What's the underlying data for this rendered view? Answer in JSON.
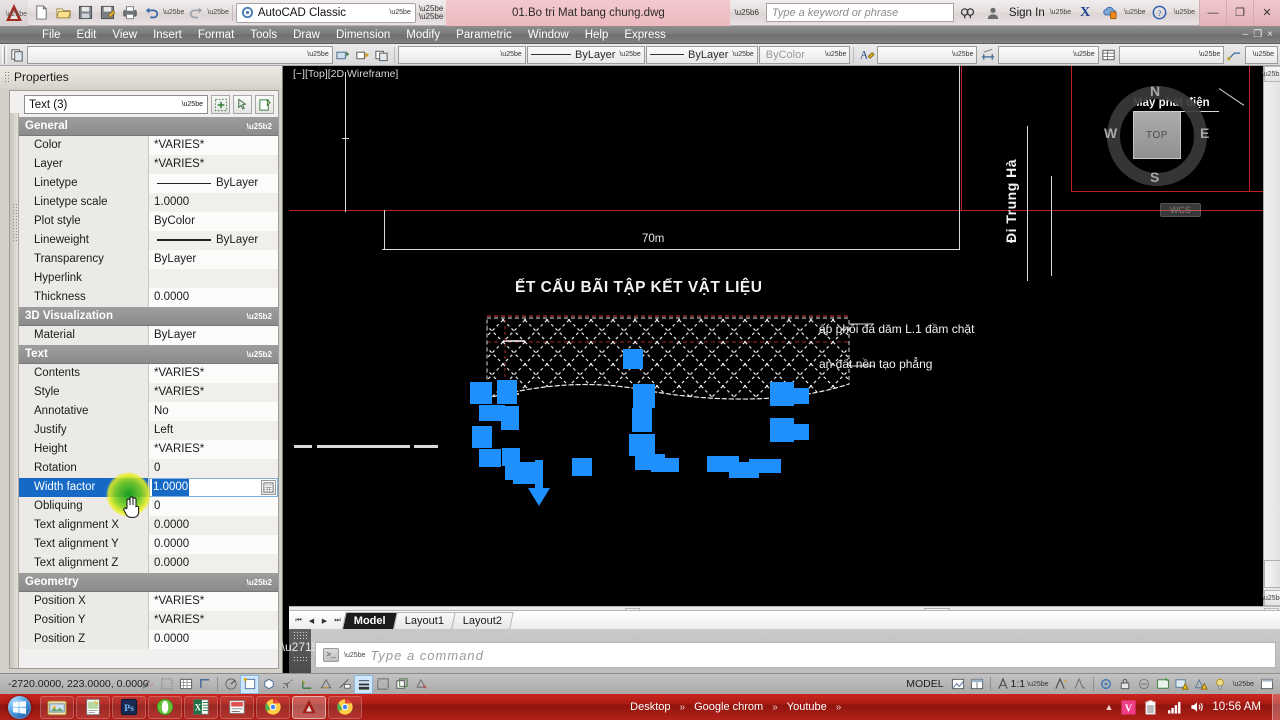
{
  "titlebar": {
    "quick_access": [
      {
        "name": "new-icon",
        "label": "New"
      },
      {
        "name": "open-icon",
        "label": "Open"
      },
      {
        "name": "save-icon",
        "label": "Save"
      },
      {
        "name": "save-as-icon",
        "label": "Save As"
      },
      {
        "name": "plot-icon",
        "label": "Plot"
      },
      {
        "name": "undo-icon",
        "label": "Undo"
      },
      {
        "name": "redo-icon",
        "label": "Redo"
      }
    ],
    "workspace": "AutoCAD Classic",
    "document_name": "01.Bo tri Mat bang chung.dwg",
    "search_placeholder": "Type a keyword or phrase",
    "sign_in": "Sign In",
    "window_buttons": {
      "minimize": "—",
      "restore": "❐",
      "close": "✕"
    }
  },
  "menubar": {
    "items": [
      "File",
      "Edit",
      "View",
      "Insert",
      "Format",
      "Tools",
      "Draw",
      "Dimension",
      "Modify",
      "Parametric",
      "Window",
      "Help",
      "Express"
    ],
    "doc_window_buttons": {
      "minimize": "–",
      "restore": "❐",
      "close": "×"
    }
  },
  "toolbar": {
    "layer_combo": "",
    "linetype_combo": "ByLayer",
    "lineweight_combo": "ByLayer",
    "plotstyle_combo": "ByColor",
    "textstyle_combo": "",
    "dimstyle_combo": "",
    "tablestyle_combo": "",
    "multileader_combo": ""
  },
  "properties": {
    "title": "Properties",
    "selection": "Text (3)",
    "toolbuttons": [
      {
        "name": "quick-select-button",
        "label": "Quick Select"
      },
      {
        "name": "select-objects-button",
        "label": "Select Objects"
      },
      {
        "name": "toggle-pickadd-button",
        "label": "Toggle PICKADD"
      }
    ],
    "categories": [
      {
        "name": "General",
        "rows": [
          {
            "key": "Color",
            "value": "*VARIES*",
            "type": "text"
          },
          {
            "key": "Layer",
            "value": "*VARIES*",
            "type": "text"
          },
          {
            "key": "Linetype",
            "value": "ByLayer",
            "type": "line"
          },
          {
            "key": "Linetype scale",
            "value": "1.0000",
            "type": "text"
          },
          {
            "key": "Plot style",
            "value": "ByColor",
            "type": "text"
          },
          {
            "key": "Lineweight",
            "value": "ByLayer",
            "type": "line"
          },
          {
            "key": "Transparency",
            "value": "ByLayer",
            "type": "text"
          },
          {
            "key": "Hyperlink",
            "value": "",
            "type": "text"
          },
          {
            "key": "Thickness",
            "value": "0.0000",
            "type": "text"
          }
        ]
      },
      {
        "name": "3D Visualization",
        "rows": [
          {
            "key": "Material",
            "value": "ByLayer",
            "type": "text"
          }
        ]
      },
      {
        "name": "Text",
        "rows": [
          {
            "key": "Contents",
            "value": "*VARIES*",
            "type": "text"
          },
          {
            "key": "Style",
            "value": "*VARIES*",
            "type": "text"
          },
          {
            "key": "Annotative",
            "value": "No",
            "type": "text"
          },
          {
            "key": "Justify",
            "value": "Left",
            "type": "text"
          },
          {
            "key": "Height",
            "value": "*VARIES*",
            "type": "text"
          },
          {
            "key": "Rotation",
            "value": "0",
            "type": "text"
          },
          {
            "key": "Width factor",
            "value": "1.0000",
            "type": "editing"
          },
          {
            "key": "Obliquing",
            "value": "0",
            "type": "text"
          },
          {
            "key": "Text alignment X",
            "value": "0.0000",
            "type": "text"
          },
          {
            "key": "Text alignment Y",
            "value": "0.0000",
            "type": "text"
          },
          {
            "key": "Text alignment Z",
            "value": "0.0000",
            "type": "text"
          }
        ]
      },
      {
        "name": "Geometry",
        "rows": [
          {
            "key": "Position X",
            "value": "*VARIES*",
            "type": "text"
          },
          {
            "key": "Position Y",
            "value": "*VARIES*",
            "type": "text"
          },
          {
            "key": "Position Z",
            "value": "0.0000",
            "type": "text"
          }
        ]
      }
    ]
  },
  "canvas": {
    "viewport_label": "[−][Top][2D Wireframe]",
    "dimension_label": "70m",
    "road_label": "Đi Trung Hà",
    "generator_label": "Máy phát điện",
    "drawing_title": "ẾT CẤU BÃI TẬP KẾT VẬT LIỆU",
    "annotation_1": "ấp phối đá dăm L.1 đầm chặt",
    "annotation_2": "an đất nền tạo phẳng",
    "viewcube": {
      "face": "TOP",
      "north": "N",
      "south": "S",
      "east": "E",
      "west": "W",
      "ucs": "WCS"
    },
    "colors": {
      "background": "#000000",
      "selection_grip": "#1e90ff",
      "construction_red": "#c02020",
      "geometry_white": "#d9d9d9"
    }
  },
  "layout_tabs": {
    "nav": [
      "⏮",
      "◀",
      "▶",
      "⏭"
    ],
    "tabs": [
      {
        "label": "Model",
        "active": true
      },
      {
        "label": "Layout1",
        "active": false
      },
      {
        "label": "Layout2",
        "active": false
      }
    ]
  },
  "command_line": {
    "placeholder": "Type a command",
    "prompt_glyph": ">_"
  },
  "statusbar": {
    "coordinates": "-2720.0000, 223.0000, 0.0000",
    "toggles": [
      {
        "name": "infer-constraints-toggle",
        "on": false
      },
      {
        "name": "snap-mode-toggle",
        "on": false
      },
      {
        "name": "grid-display-toggle",
        "on": false
      },
      {
        "name": "ortho-mode-toggle",
        "on": false
      },
      {
        "name": "polar-tracking-toggle",
        "on": false
      },
      {
        "name": "object-snap-toggle",
        "on": true
      },
      {
        "name": "3d-object-snap-toggle",
        "on": false
      },
      {
        "name": "object-snap-tracking-toggle",
        "on": false
      },
      {
        "name": "allow-ucs-toggle",
        "on": false
      },
      {
        "name": "dynamic-ucs-toggle",
        "on": false
      },
      {
        "name": "dynamic-input-toggle",
        "on": false
      },
      {
        "name": "lineweight-toggle",
        "on": true
      },
      {
        "name": "transparency-toggle",
        "on": false
      },
      {
        "name": "selection-cycling-toggle",
        "on": false
      },
      {
        "name": "annotation-monitor-toggle",
        "on": false
      }
    ],
    "space_button": "MODEL",
    "annotation_scale": "1:1",
    "right_icons": [
      {
        "name": "viewport-icon"
      },
      {
        "name": "layout-icon"
      },
      {
        "name": "annotation-visibility-icon"
      },
      {
        "name": "auto-scale-icon"
      },
      {
        "name": "workspace-gear-icon"
      },
      {
        "name": "lock-toolbars-icon"
      },
      {
        "name": "isolate-objects-icon"
      },
      {
        "name": "hardware-accel-icon"
      },
      {
        "name": "tray-warning-icon"
      },
      {
        "name": "clean-screen-icon"
      }
    ]
  },
  "taskbar": {
    "start_label": "Start",
    "pinned": [
      {
        "name": "taskbar-explorer",
        "active": false
      },
      {
        "name": "taskbar-notepad",
        "active": false
      },
      {
        "name": "taskbar-photoshop",
        "active": false
      },
      {
        "name": "taskbar-opera",
        "active": false
      },
      {
        "name": "taskbar-excel",
        "active": false
      },
      {
        "name": "taskbar-unikey",
        "active": false
      },
      {
        "name": "taskbar-chrome-1",
        "active": false
      },
      {
        "name": "taskbar-autocad",
        "active": true
      },
      {
        "name": "taskbar-chrome-2",
        "active": false
      }
    ],
    "toolbars": [
      {
        "label": "Desktop"
      },
      {
        "label": "Google chrom"
      },
      {
        "label": "Youtube"
      }
    ],
    "chevron": "»",
    "tray_expand": "▲",
    "tray": [
      {
        "name": "unikey-tray-icon",
        "label": "V"
      },
      {
        "name": "battery-tray-icon"
      },
      {
        "name": "network-tray-icon"
      },
      {
        "name": "volume-tray-icon"
      }
    ],
    "clock": "10:56 AM"
  }
}
